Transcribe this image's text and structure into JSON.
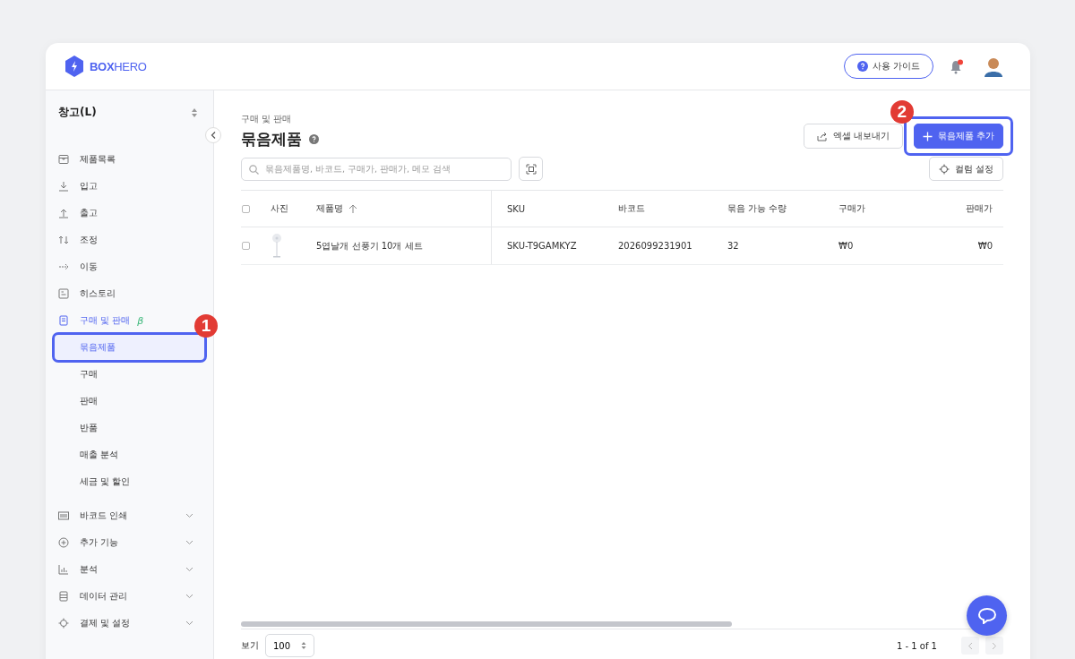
{
  "brand": {
    "name_bold": "BOX",
    "name_light": "HERO"
  },
  "header": {
    "guide_button": "사용 가이드",
    "notification_dot": true
  },
  "sidebar": {
    "warehouse": "창고(L)",
    "items": [
      {
        "kind": "link",
        "label": "제품목록",
        "active": false
      },
      {
        "kind": "link",
        "label": "입고",
        "active": false
      },
      {
        "kind": "link",
        "label": "출고",
        "active": false
      },
      {
        "kind": "link",
        "label": "조정",
        "active": false
      },
      {
        "kind": "link",
        "label": "이동",
        "active": false
      },
      {
        "kind": "link",
        "label": "히스토리",
        "active": false
      },
      {
        "kind": "section",
        "label": "구매 및 판매",
        "badge": "β",
        "active": true,
        "children": [
          {
            "label": "묶음제품",
            "selected": true,
            "callout": "1"
          },
          {
            "label": "구매",
            "selected": false
          },
          {
            "label": "판매",
            "selected": false
          },
          {
            "label": "반품",
            "selected": false
          },
          {
            "label": "매출 분석",
            "selected": false
          },
          {
            "label": "세금 및 할인",
            "selected": false
          }
        ]
      },
      {
        "kind": "group",
        "label": "바코드 인쇄",
        "active": false,
        "expanded": false
      },
      {
        "kind": "group",
        "label": "추가 기능",
        "active": false,
        "expanded": false
      },
      {
        "kind": "group",
        "label": "분석",
        "active": false,
        "expanded": false
      },
      {
        "kind": "group",
        "label": "데이터 관리",
        "active": false,
        "expanded": false
      },
      {
        "kind": "group",
        "label": "결제 및 설정",
        "active": false,
        "expanded": false
      }
    ]
  },
  "page": {
    "breadcrumb": "구매 및 판매",
    "title": "묶음제품",
    "export_button": "엑셀 내보내기",
    "add_button": {
      "label": "묶음제품 추가",
      "callout": "2"
    },
    "search": {
      "placeholder": "묶음제품명, 바코드, 구매가, 판매가, 메모 검색"
    },
    "column_settings": "컬럼 설정"
  },
  "table": {
    "all_checked": false,
    "photo_column": "사진",
    "columns": [
      {
        "label": "제품명",
        "sorted": true
      },
      {
        "label": "SKU",
        "sorted": false
      },
      {
        "label": "바코드",
        "sorted": false
      },
      {
        "label": "묶음 가능 수량",
        "sorted": false
      },
      {
        "label": "구매가",
        "sorted": false
      },
      {
        "label": "판매가",
        "sorted": false
      }
    ],
    "rows": [
      {
        "checked": false,
        "cells": [
          "5엽날개 선풍기 10개 세트",
          "SKU-T9GAMKYZ",
          "2026099231901",
          "32",
          "₩0",
          "₩0"
        ]
      }
    ]
  },
  "footer": {
    "page_size_label": "보기",
    "page_size": "100",
    "range": "1 - 1 of 1",
    "prev_disabled": true,
    "next_disabled": true
  }
}
